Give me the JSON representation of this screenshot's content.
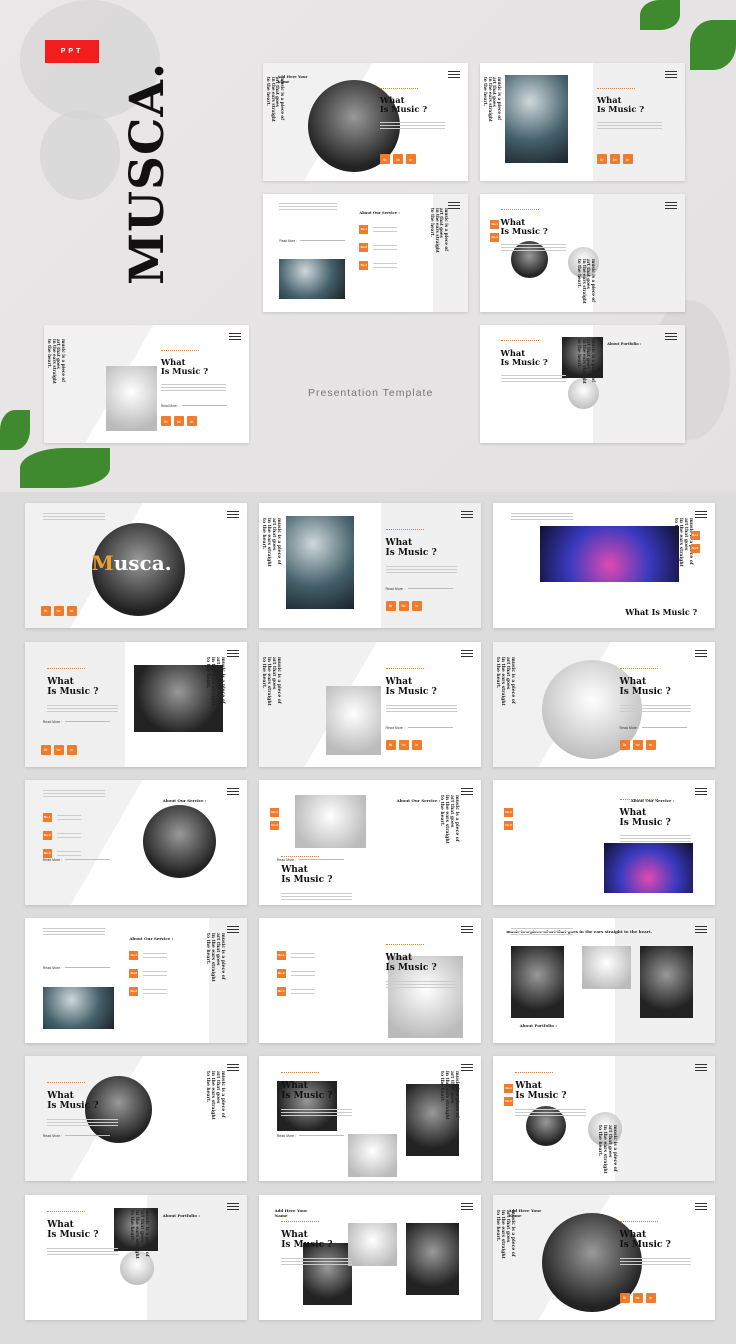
{
  "badge": "PPT",
  "brand": "MUSCA.",
  "tagline": "Presentation Template",
  "colors": {
    "accent": "#f07b2c",
    "badge": "#f21d1d",
    "background": "#e8e6e6",
    "grid": "#dcdcdc"
  },
  "common": {
    "title": "What\nIs Music ?",
    "quote": "music is a piece of\nart that goes\nin the ears straight\nto the heart.",
    "read_more": "Read More :",
    "about_service": "About Our Service :",
    "about_portfolio": "About Portfolio :",
    "name": "Add Here Your\nName",
    "social": [
      "fb",
      "tw",
      "in"
    ],
    "services": [
      "No.1",
      "No.2",
      "No.3"
    ]
  },
  "showcase": [
    {
      "variant": "portrait-circle",
      "img": "dark",
      "name": true,
      "quote": true,
      "title": true,
      "social": true
    },
    {
      "variant": "photo-left",
      "img": "color",
      "quote": true,
      "title": true,
      "social": true
    },
    {
      "variant": "services",
      "img": "color",
      "services": true,
      "about": "service",
      "more": true,
      "quote": true
    },
    {
      "variant": "circles",
      "img": "dark",
      "title": true,
      "quote": true,
      "services2": true
    },
    {
      "variant": "guitar",
      "img": "light",
      "quote": true,
      "title": true,
      "social": true,
      "more": true
    },
    {
      "variant": "portfolio",
      "img": "dark",
      "title": true,
      "about": "portfolio",
      "quote": true
    }
  ],
  "slides": [
    {
      "variant": "cover",
      "img": "dark",
      "musca": "Musca.",
      "social": true
    },
    {
      "variant": "photo-left",
      "img": "color",
      "quote": true,
      "title": true,
      "social": true,
      "more": true
    },
    {
      "variant": "banner",
      "img": "concert",
      "quote": true,
      "title_inline": "What Is Music ?",
      "services2": true
    },
    {
      "variant": "photo-right",
      "img": "dark",
      "title": true,
      "social": true,
      "quote": true,
      "more": true
    },
    {
      "variant": "guitar",
      "img": "light",
      "quote": true,
      "title": true,
      "social": true,
      "more": true
    },
    {
      "variant": "portrait-circle",
      "img": "light",
      "quote": true,
      "title": true,
      "social": true,
      "more": true
    },
    {
      "variant": "services-circle",
      "img": "dark",
      "services": true,
      "about": "service",
      "more": true
    },
    {
      "variant": "photo-top",
      "img": "light",
      "title": true,
      "services2": true,
      "about": "service",
      "more": true,
      "quote": true
    },
    {
      "variant": "banner-low",
      "img": "concert",
      "title": true,
      "services2": true,
      "about": "service"
    },
    {
      "variant": "services",
      "img": "color",
      "services": true,
      "about": "service",
      "more": true,
      "quote": true
    },
    {
      "variant": "services-photo",
      "img": "light",
      "services": true,
      "title": true
    },
    {
      "variant": "three-photos",
      "img": "dark",
      "about": "portfolio",
      "quote_inline": "music is a piece of art that goes in the ears straight to the heart."
    },
    {
      "variant": "record",
      "img": "dark",
      "title": true,
      "quote": true,
      "more": true
    },
    {
      "variant": "collage",
      "img": "dark",
      "title": true,
      "quote": true,
      "more": true
    },
    {
      "variant": "circles",
      "img": "dark",
      "title": true,
      "quote": true,
      "services2": true
    },
    {
      "variant": "portfolio",
      "img": "dark",
      "title": true,
      "about": "portfolio",
      "quote": true
    },
    {
      "variant": "team",
      "img": "dark",
      "title": true,
      "name": true
    },
    {
      "variant": "portrait-circle",
      "img": "dark",
      "name": true,
      "quote": true,
      "title": true,
      "social": true
    }
  ]
}
